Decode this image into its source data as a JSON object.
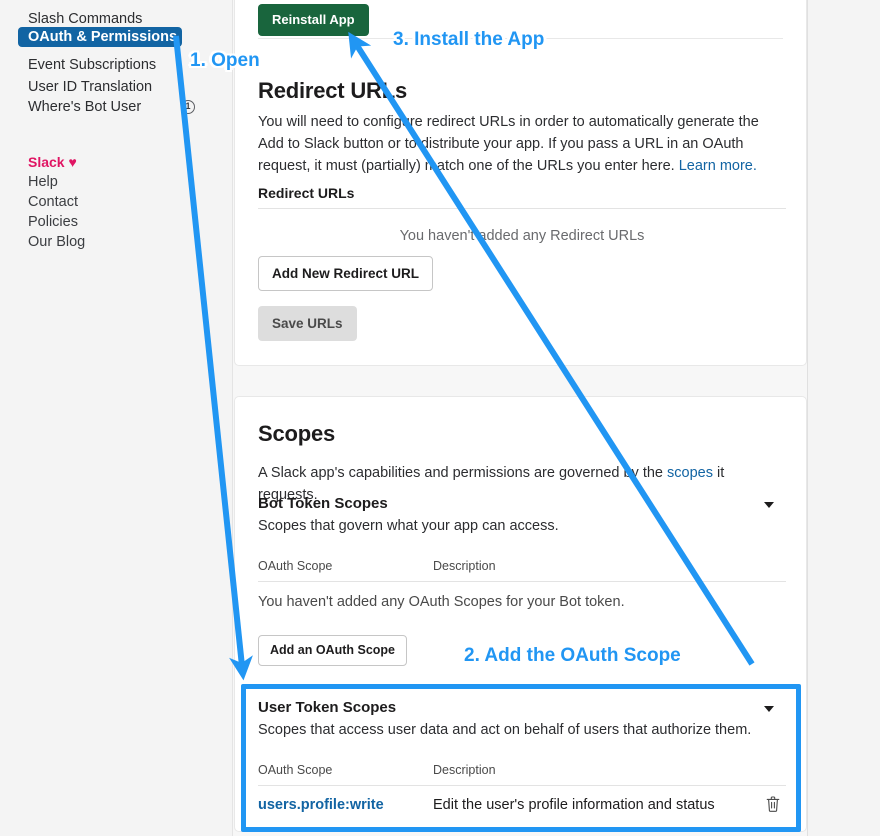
{
  "sidebar": {
    "nav_items": [
      {
        "label": "Slash Commands",
        "active": false,
        "badge": null
      },
      {
        "label": "OAuth & Permissions",
        "active": true,
        "badge": null
      },
      {
        "label": "Event Subscriptions",
        "active": false,
        "badge": null
      },
      {
        "label": "User ID Translation",
        "active": false,
        "badge": null
      },
      {
        "label": "Where's Bot User",
        "active": false,
        "badge": "1"
      }
    ],
    "footer": {
      "brand": "Slack ♥",
      "links": [
        {
          "label": "Help"
        },
        {
          "label": "Contact"
        },
        {
          "label": "Policies"
        },
        {
          "label": "Our Blog"
        }
      ]
    }
  },
  "topbar": {
    "reinstall_label": "Reinstall App"
  },
  "redirect_card": {
    "heading": "Redirect URLs",
    "description_part1": "You will need to configure redirect URLs in order to automatically generate the Add to Slack button or to distribute your app. If you pass a URL in an OAuth request, it must (partially) match one of the URLs you enter here. ",
    "learn_more": "Learn more.",
    "sub_label": "Redirect URLs",
    "empty_note": "You haven't added any Redirect URLs",
    "add_button": "Add New Redirect URL",
    "save_button": "Save URLs"
  },
  "scopes_card": {
    "heading": "Scopes",
    "description_pre": "A Slack app's capabilities and permissions are governed by the ",
    "description_link": "scopes",
    "description_post": " it requests.",
    "bot_group": {
      "title": "Bot Token Scopes",
      "desc": "Scopes that govern what your app can access.",
      "col_scope": "OAuth Scope",
      "col_description": "Description",
      "empty_note": "You haven't added any OAuth Scopes for your Bot token.",
      "add_button": "Add an OAuth Scope"
    },
    "user_group": {
      "title": "User Token Scopes",
      "desc": "Scopes that access user data and act on behalf of users that authorize them.",
      "col_scope": "OAuth Scope",
      "col_description": "Description",
      "rows": [
        {
          "scope": "users.profile:write",
          "description": "Edit the user's profile information and status",
          "delete_icon": "trash-icon"
        }
      ]
    }
  },
  "annotations": {
    "step1": "1. Open",
    "step2": "2. Add the OAuth Scope",
    "step3": "3. Install the App",
    "accent_color": "#2196f3"
  },
  "colors": {
    "nav_active_bg": "#1264a3",
    "brand_pink": "#e01563",
    "green_button": "#19653d",
    "link_blue": "#1264a3",
    "annotation_blue": "#2196f3",
    "page_bg": "#f7f7f7",
    "card_bg": "#ffffff"
  }
}
